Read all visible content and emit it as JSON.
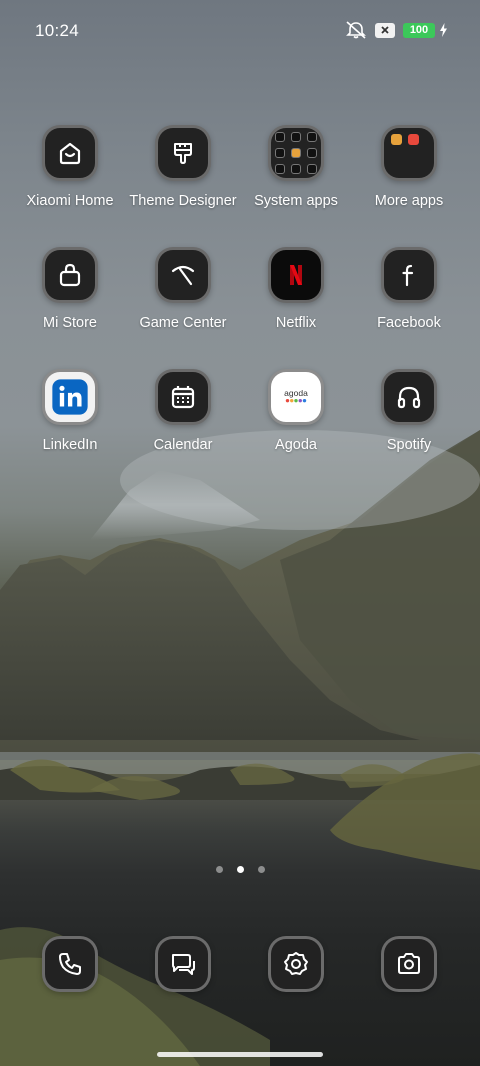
{
  "status_bar": {
    "time": "10:24",
    "battery_level": "100",
    "icons": [
      "mute-icon",
      "sim-x-icon",
      "battery-icon",
      "charging-bolt-icon"
    ]
  },
  "apps": [
    {
      "label": "Xiaomi Home",
      "icon": "xiaomi-home-icon"
    },
    {
      "label": "Theme Designer",
      "icon": "theme-brush-icon"
    },
    {
      "label": "System apps",
      "icon": "folder-icon"
    },
    {
      "label": "More apps",
      "icon": "folder-icon"
    },
    {
      "label": "Mi Store",
      "icon": "shopping-bag-icon"
    },
    {
      "label": "Game Center",
      "icon": "game-center-icon"
    },
    {
      "label": "Netflix",
      "icon": "netflix-icon"
    },
    {
      "label": "Facebook",
      "icon": "facebook-icon"
    },
    {
      "label": "LinkedIn",
      "icon": "linkedin-icon"
    },
    {
      "label": "Calendar",
      "icon": "calendar-icon"
    },
    {
      "label": "Agoda",
      "icon": "agoda-icon",
      "logo_text": "agoda"
    },
    {
      "label": "Spotify",
      "icon": "headphones-icon"
    }
  ],
  "page_indicator": {
    "count": 3,
    "active": 2
  },
  "dock": [
    {
      "icon": "phone-icon"
    },
    {
      "icon": "messages-icon"
    },
    {
      "icon": "settings-icon"
    },
    {
      "icon": "camera-icon"
    }
  ],
  "colors": {
    "netflix_red": "#e50914",
    "linkedin_blue": "#0a66c2",
    "battery_green": "#3cc85a"
  }
}
